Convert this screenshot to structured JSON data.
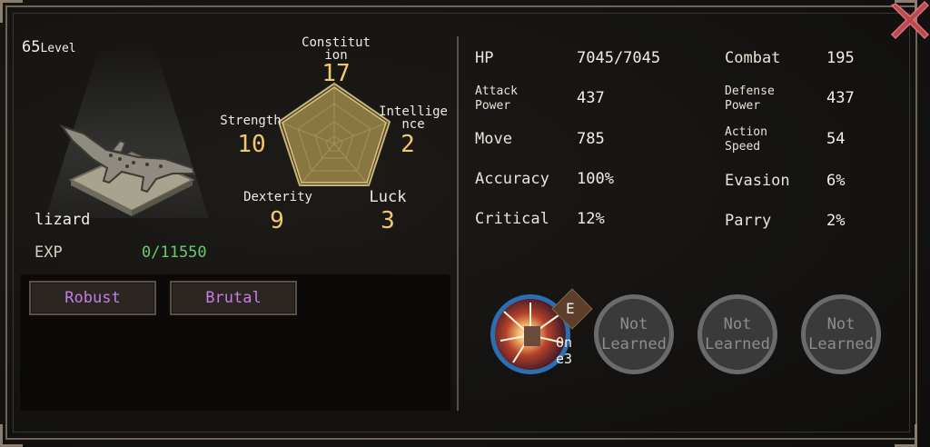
{
  "character": {
    "level": "65",
    "level_suffix": "Level",
    "name": "lizard",
    "exp_label": "EXP",
    "exp_value": "0/11550"
  },
  "attributes": {
    "constitution": {
      "label": "Constitut ion",
      "value": "17"
    },
    "strength": {
      "label": "Strength",
      "value": "10"
    },
    "intelligence": {
      "label": "Intellige nce",
      "value": "2"
    },
    "dexterity": {
      "label": "Dexterity",
      "value": "9"
    },
    "luck": {
      "label": "Luck",
      "value": "3"
    }
  },
  "traits": [
    "Robust",
    "Brutal"
  ],
  "stats": {
    "hp": {
      "label": "HP",
      "value": "7045/7045"
    },
    "attack_power": {
      "label": "Attack Power",
      "value": "437"
    },
    "move": {
      "label": "Move",
      "value": "785"
    },
    "accuracy": {
      "label": "Accuracy",
      "value": "100%"
    },
    "critical": {
      "label": "Critical",
      "value": "12%"
    },
    "combat": {
      "label": "Combat",
      "value": "195"
    },
    "defense_power": {
      "label": "Defense Power",
      "value": "437"
    },
    "action_speed": {
      "label": "Action Speed",
      "value": "54"
    },
    "evasion": {
      "label": "Evasion",
      "value": "6%"
    },
    "parry": {
      "label": "Parry",
      "value": "2%"
    }
  },
  "skills": {
    "active": {
      "tag": "E",
      "name": "On e3"
    },
    "locked_label": "Not Learned"
  },
  "colors": {
    "stat_value": "#f2c86c",
    "exp_value": "#5fcf6a",
    "trait_text": "#c47de6",
    "close": "#e0505a"
  },
  "icons": [
    "close-icon",
    "radar-chart",
    "lizard-portrait",
    "skill-icon"
  ]
}
